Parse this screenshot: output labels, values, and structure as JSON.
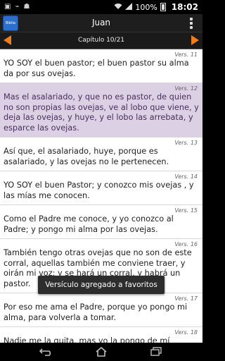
{
  "status_bar": {
    "battery_percent_label": "100%",
    "time": "18:02"
  },
  "header": {
    "app_icon_label": "Biblia",
    "title": "Juan"
  },
  "chapter_nav": {
    "label": "Capítulo 10/21"
  },
  "verses": [
    {
      "num": "Vers. 11",
      "text": "YO SOY el buen pastor; el buen pastor su alma da por sus ovejas.",
      "highlight": false
    },
    {
      "num": "Vers. 12",
      "text": "Mas el asalariado, y que no es pastor, de quien no son propias las ovejas, ve al lobo que viene, y deja las ovejas, y huye, y el lobo las arrebata, y esparce las ovejas.",
      "highlight": true
    },
    {
      "num": "Vers. 13",
      "text": "Así que, el asalariado, huye, porque es asalariado, y las ovejas no le pertenecen.",
      "highlight": false
    },
    {
      "num": "Vers. 14",
      "text": "YO SOY el buen Pastor; y conozco mis ovejas , y las mías me conocen.",
      "highlight": false
    },
    {
      "num": "Vers. 15",
      "text": "Como el Padre me conoce, y yo conozco al Padre; y pongo mi alma por las ovejas.",
      "highlight": false
    },
    {
      "num": "Vers. 16",
      "text": "También tengo otras ovejas que no son de este corral, aquellas también me conviene traer, y oirán mi voz; y se hará un corral, y habrá un pastor.",
      "highlight": false
    },
    {
      "num": "Vers. 17",
      "text": "Por eso me ama el Padre, porque yo pongo mi alma, para volverla a tomar.",
      "highlight": false
    },
    {
      "num": "Vers. 18",
      "text": "Nadie me la quita, mas yo la pongo de mí mismo. Tengo poder para ponerla, y tengo poder para volverla a tomar.",
      "highlight": false
    }
  ],
  "toast": {
    "message": "Versículo agregado a favoritos"
  },
  "colors": {
    "accent_orange": "#ee7d1f",
    "highlight_bg": "#dcd0e4",
    "app_icon_blue": "#2d6ecb"
  }
}
